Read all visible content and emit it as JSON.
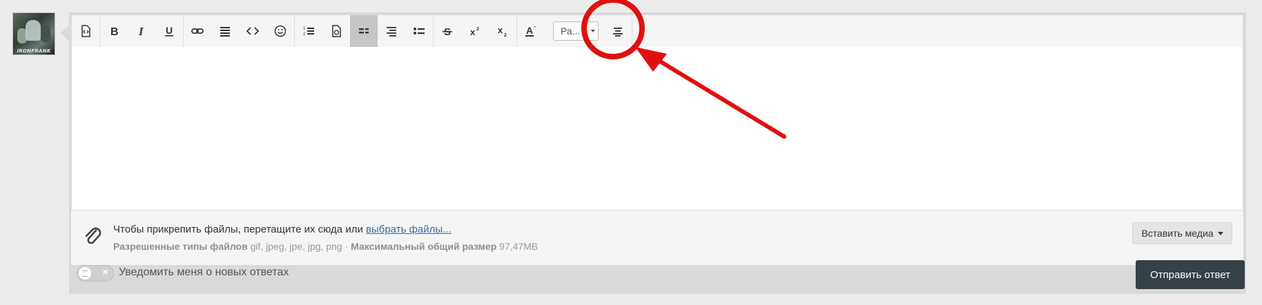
{
  "avatar": {
    "caption": "iRONFRANK"
  },
  "toolbar": {
    "buttons": [
      {
        "name": "source-code-icon"
      },
      {
        "name": "bold-icon"
      },
      {
        "name": "italic-icon"
      },
      {
        "name": "underline-icon"
      },
      {
        "name": "link-icon"
      },
      {
        "name": "align-justify-icon"
      },
      {
        "name": "code-icon"
      },
      {
        "name": "emoji-icon"
      },
      {
        "name": "ordered-list-icon"
      },
      {
        "name": "template-icon"
      },
      {
        "name": "align-left-icon",
        "active": true
      },
      {
        "name": "align-right-icon"
      },
      {
        "name": "unordered-list-icon"
      },
      {
        "name": "strikethrough-icon"
      },
      {
        "name": "superscript-icon"
      },
      {
        "name": "subscript-icon"
      },
      {
        "name": "text-color-icon"
      },
      {
        "name": "align-center-icon"
      }
    ],
    "font_select_value": "Ра..."
  },
  "attach": {
    "text": "Чтобы прикрепить файлы, перетащите их сюда или ",
    "link": "выбрать файлы...",
    "types_label": "Разрешенные типы файлов",
    "types": " gif, jpeg, jpe, jpg, png · ",
    "max_label": "Максимальный общий размер",
    "max_value": " 97,47MB",
    "media_button": "Вставить медиа"
  },
  "footer": {
    "notify_label": "Уведомить меня о новых ответах",
    "send_button": "Отправить ответ"
  },
  "colors": {
    "annotation": "#e01010",
    "send_button_bg": "#354047",
    "link": "#3a6d9c"
  }
}
